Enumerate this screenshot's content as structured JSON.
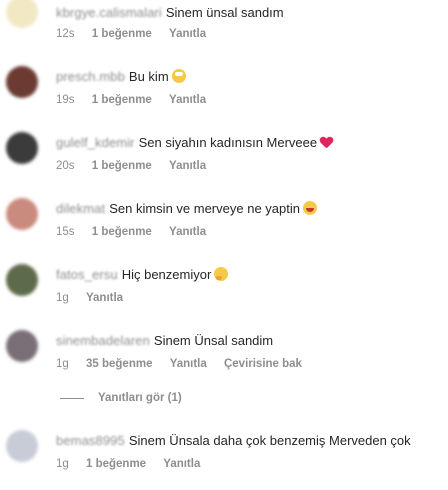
{
  "comments": [
    {
      "user": "kbrgye.calismalari",
      "text": "Sinem ünsal sandım",
      "emoji": "",
      "time": "12s",
      "likes": "1 beğenme",
      "reply": "Yanıtla",
      "avatar_color": "#f2e9c4"
    },
    {
      "user": "presch.mbb",
      "text": "Bu kim",
      "emoji": "face-with-rolling-eyes",
      "time": "19s",
      "likes": "1 beğenme",
      "reply": "Yanıtla",
      "avatar_color": "#6b3b32"
    },
    {
      "user": "gulelf_kdemir",
      "text": "Sen siyahın kadınısın Merveee",
      "emoji": "heart",
      "time": "20s",
      "likes": "1 beğenme",
      "reply": "Yanıtla",
      "avatar_color": "#3b3b3b"
    },
    {
      "user": "dilekmat",
      "text": "Sen kimsin ve merveye ne yaptin",
      "emoji": "laughing-face",
      "time": "15s",
      "likes": "1 beğenme",
      "reply": "Yanıtla",
      "avatar_color": "#c98b7d"
    },
    {
      "user": "fatos_ersu",
      "text": "Hiç benzemiyor",
      "emoji": "thinking-face",
      "time": "1g",
      "likes": "",
      "reply": "Yanıtla",
      "avatar_color": "#5d6b4a"
    },
    {
      "user": "sinembadelaren",
      "text": "Sinem Ünsal sandim",
      "emoji": "",
      "time": "1g",
      "likes": "35 beğenme",
      "reply": "Yanıtla",
      "translate": "Çevirisine bak",
      "avatar_color": "#7a6f77"
    },
    {
      "user": "bemas8995",
      "text": "Sinem Ünsala daha çok benzemiş Merveden çok",
      "emoji": "",
      "time": "1g",
      "likes": "1 beğenme",
      "reply": "Yanıtla",
      "avatar_color": "#c7ccd6"
    }
  ],
  "view_replies": "Yanıtları gör (1)",
  "colors": {
    "meta": "#8e8e8e",
    "heart": "#e0245e",
    "emoji": "#f7c948"
  }
}
